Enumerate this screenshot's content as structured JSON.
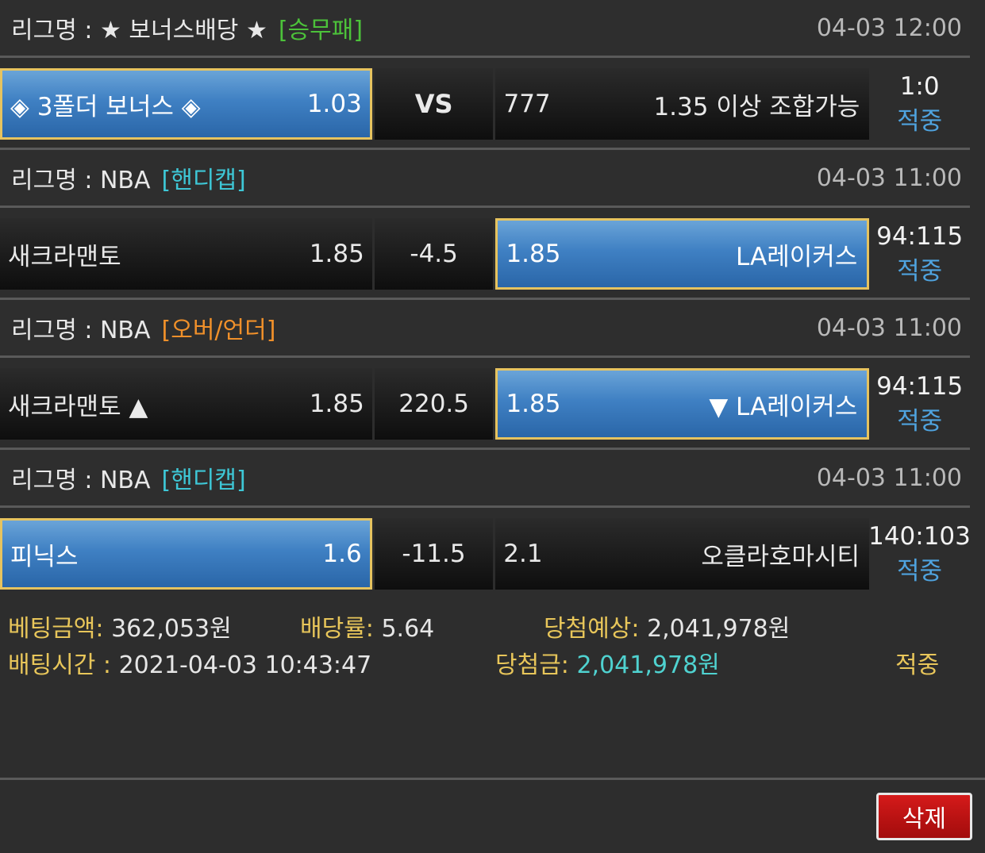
{
  "bets": [
    {
      "league_label": "리그명 : ★ 보너스배당 ★",
      "tag": "[승무패]",
      "tag_color": "#4cc23a",
      "time": "04-03 12:00",
      "home_name": "◈ 3폴더 보너스 ◈",
      "home_odds": "1.03",
      "middle": "VS",
      "away_odds": "777",
      "away_name": "1.35 이상 조합가능",
      "selected": "home",
      "score": "1:0",
      "result": "적중"
    },
    {
      "league_label": "리그명 : NBA",
      "tag": "[핸디캡]",
      "tag_color": "#3ec7d6",
      "time": "04-03 11:00",
      "home_name": "새크라맨토",
      "home_odds": "1.85",
      "middle": "-4.5",
      "away_odds": "1.85",
      "away_name": "LA레이커스",
      "selected": "away",
      "score": "94:115",
      "result": "적중"
    },
    {
      "league_label": "리그명 : NBA",
      "tag": "[오버/언더]",
      "tag_color": "#f0902a",
      "time": "04-03 11:00",
      "home_name": "새크라맨토 ▲",
      "home_odds": "1.85",
      "middle": "220.5",
      "away_odds": "1.85",
      "away_name": "▼ LA레이커스",
      "selected": "away",
      "score": "94:115",
      "result": "적중"
    },
    {
      "league_label": "리그명 : NBA",
      "tag": "[핸디캡]",
      "tag_color": "#3ec7d6",
      "time": "04-03 11:00",
      "home_name": "피닉스",
      "home_odds": "1.6",
      "middle": "-11.5",
      "away_odds": "2.1",
      "away_name": "오클라호마시티",
      "selected": "home",
      "score": "140:103",
      "result": "적중"
    }
  ],
  "summary": {
    "amount_label": "베팅금액:",
    "amount_value": "362,053원",
    "odds_label": "배당률:",
    "odds_value": "5.64",
    "expected_label": "당첨예상:",
    "expected_value": "2,041,978원",
    "time_label": "배팅시간 :",
    "time_value": "2021-04-03 10:43:47",
    "win_label": "당첨금:",
    "win_value": "2,041,978원",
    "status": "적중"
  },
  "delete_label": "삭제"
}
